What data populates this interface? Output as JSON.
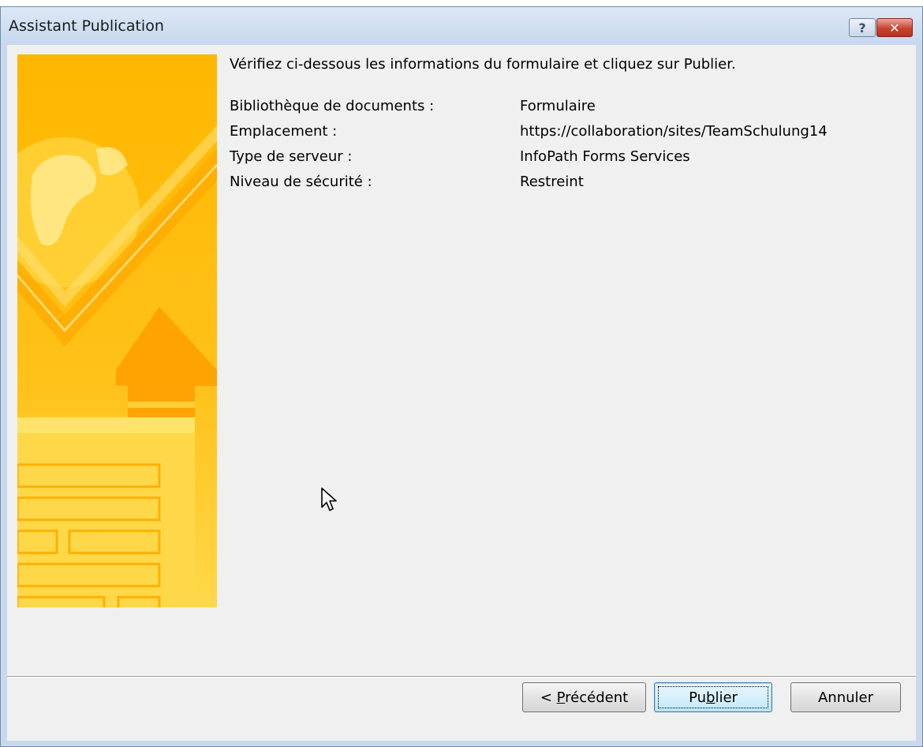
{
  "window": {
    "title": "Assistant Publication",
    "help_glyph": "?",
    "close_glyph": "✕"
  },
  "instruction": "Vérifiez ci-dessous les informations du formulaire et cliquez sur Publier.",
  "info": [
    {
      "label": "Bibliothèque de documents :",
      "value": "Formulaire"
    },
    {
      "label": "Emplacement :",
      "value": "https://collaboration/sites/TeamSchulung14"
    },
    {
      "label": "Type de serveur :",
      "value": "InfoPath Forms Services"
    },
    {
      "label": "Niveau de sécurité :",
      "value": "Restreint"
    }
  ],
  "buttons": {
    "prev_prefix": "< ",
    "prev_mnemonic": "P",
    "prev_rest": "récédent",
    "publish_before": "Pu",
    "publish_mnemonic": "b",
    "publish_after": "lier",
    "cancel": "Annuler"
  },
  "icons": {
    "help": "help-icon",
    "close": "close-icon",
    "banner": "globe-upload-banner",
    "cursor": "mouse-pointer-icon"
  },
  "colors": {
    "banner_gold": "#ffc000",
    "banner_light": "#ffe26a",
    "close_red": "#c7442e",
    "dialog_face": "#f0f0f0"
  }
}
